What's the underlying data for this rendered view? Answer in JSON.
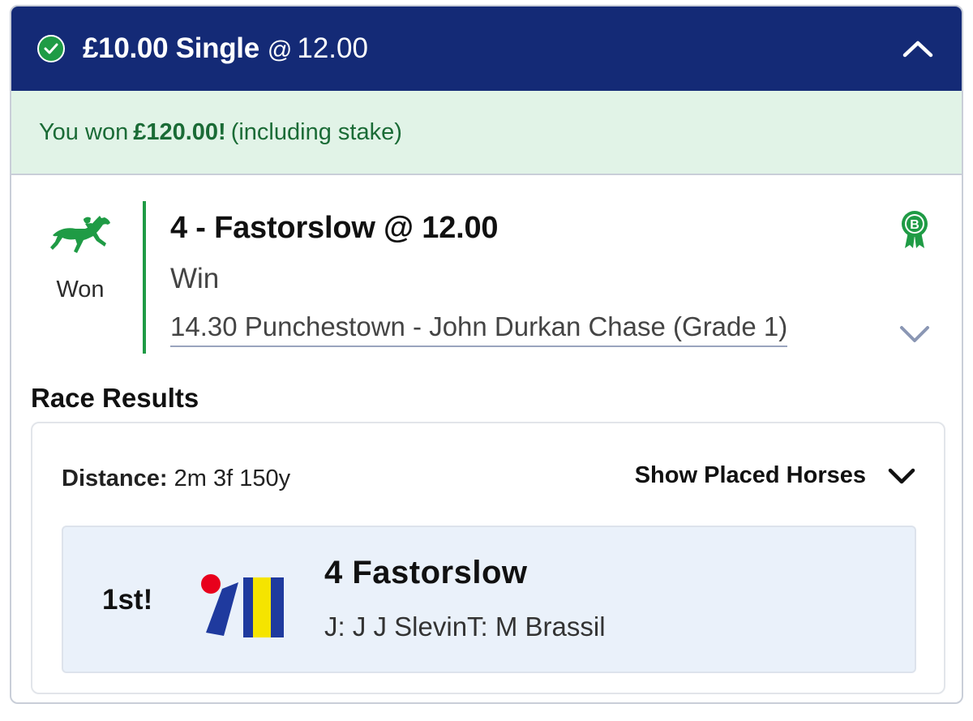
{
  "bet": {
    "title": "£10.00 Single",
    "odds_at": "@",
    "odds": "12.00"
  },
  "won_banner": {
    "prefix": "You won",
    "amount": "£120.00!",
    "suffix": "(including stake)"
  },
  "selection": {
    "status": "Won",
    "title": "4 - Fastorslow @ 12.00",
    "market": "Win",
    "event": "14.30 Punchestown - John Durkan Chase (Grade 1)",
    "badge_letter": "B"
  },
  "race_results": {
    "heading": "Race Results",
    "distance_label": "Distance:",
    "distance_value": "2m 3f 150y",
    "show_placed_label": "Show Placed Horses",
    "runners": [
      {
        "position": "1st!",
        "name": "4 Fastorslow",
        "connections": "J: J J SlevinT: M Brassil"
      }
    ]
  },
  "colors": {
    "header_bg": "#142a76",
    "success_green": "#1f9b45",
    "won_banner_bg": "#e1f3e7",
    "result_row_bg": "#eaf1fa",
    "silks_blue": "#1f3a9e",
    "silks_yellow": "#f5e400",
    "silks_red": "#e8001c"
  },
  "icons": {
    "check": "check-circle-icon",
    "collapse": "chevron-up-icon",
    "status": "racehorse-icon",
    "badge": "rosette-b-icon",
    "expand": "chevron-down-icon",
    "show_placed": "chevron-down-icon",
    "silks": "jockey-silks-icon"
  }
}
